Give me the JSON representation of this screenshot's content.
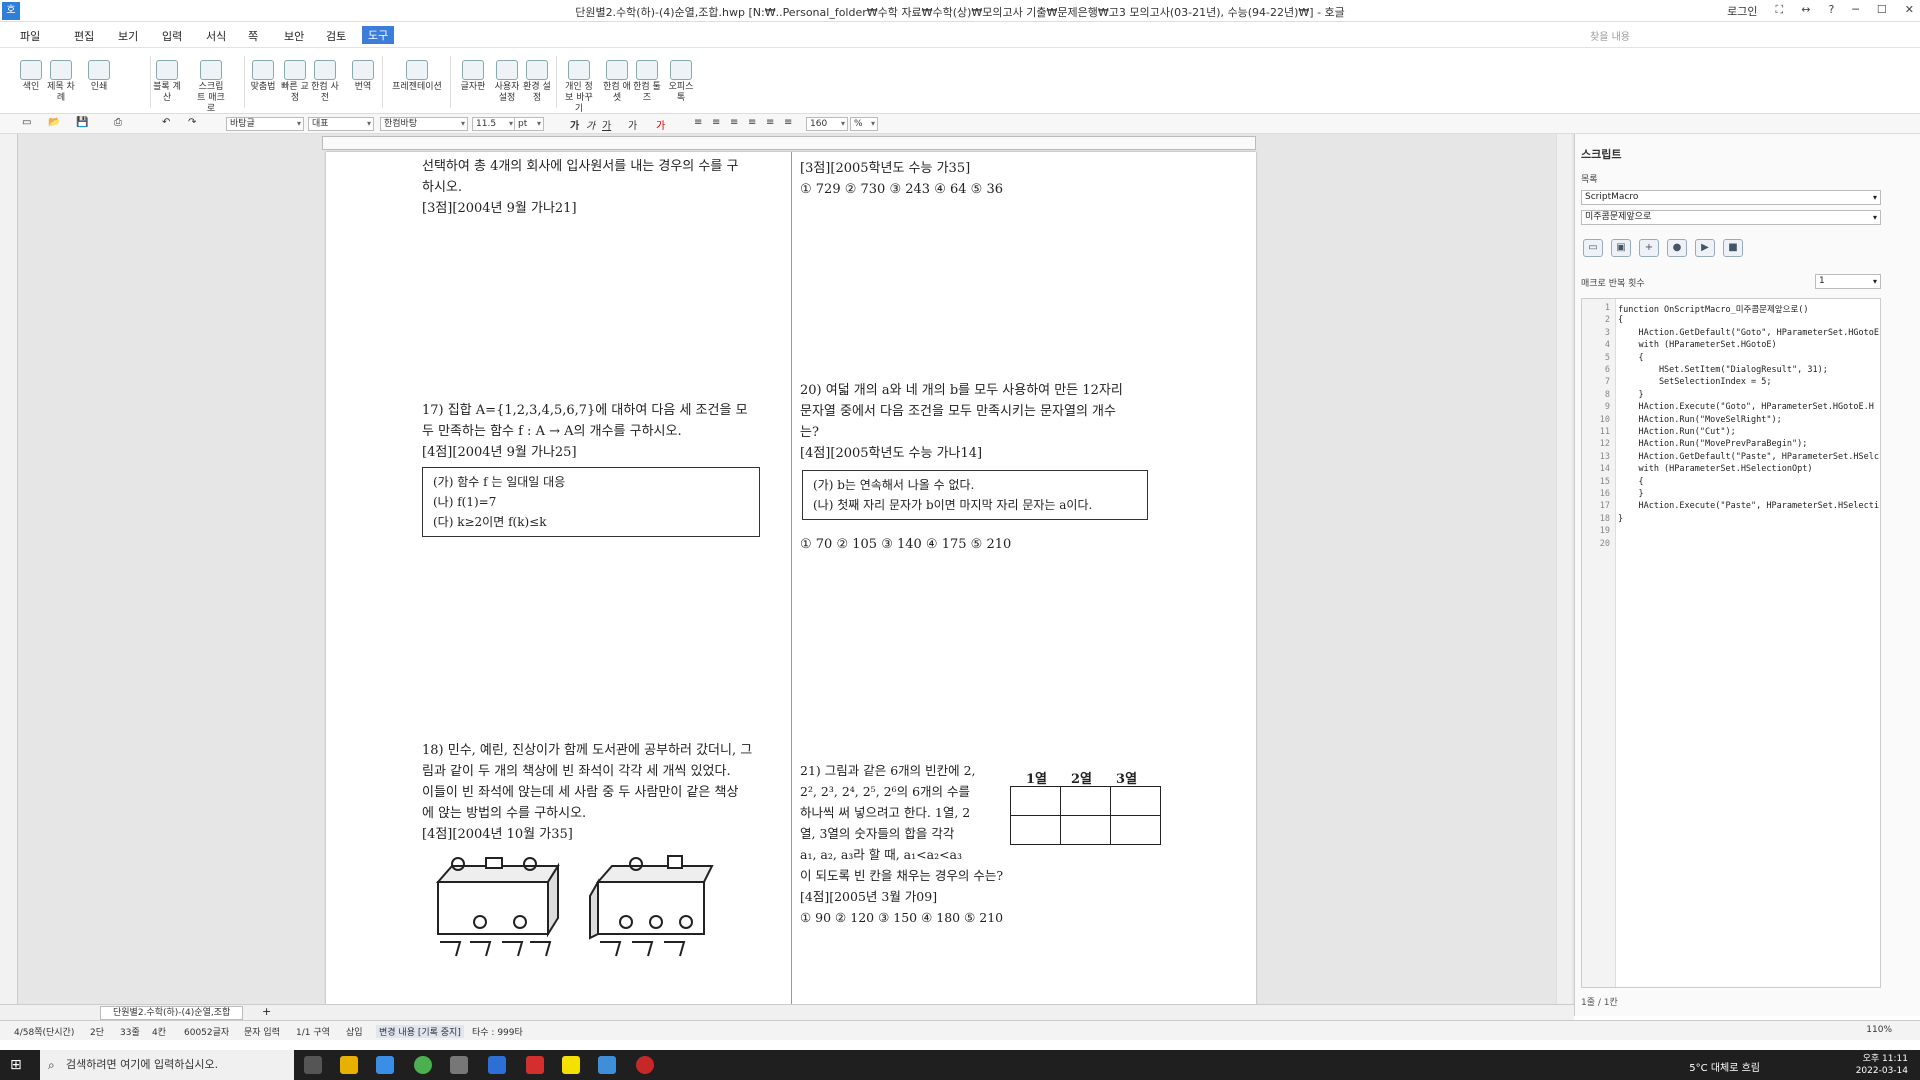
{
  "window": {
    "app_logo": "호",
    "title": "단원별2.수학(하)-(4)순열,조합.hwp [N:₩..Personal_folder₩수학 자료₩수학(상)₩모의고사 기출₩문제은행₩고3 모의고사(03-21년), 수능(94-22년)₩] - 호글",
    "login": "로그인"
  },
  "menu": {
    "items": [
      "파일",
      "편집",
      "보기",
      "입력",
      "서식",
      "쪽",
      "보안",
      "검토",
      "도구"
    ],
    "active": "도구",
    "help_search": "찾을 내용"
  },
  "ribbon": {
    "buttons": [
      "색인",
      "제목 차례",
      "인쇄",
      "블록 계산",
      "스크립트 매크로",
      "맞춤법",
      "빠른 교정",
      "한컴 사전",
      "번역",
      "프레젠테이션",
      "글자판",
      "사용자 설정",
      "환경 설정",
      "개인 정보 바꾸기",
      "한컴 애셋",
      "한컴 툴즈",
      "오피스 톡"
    ]
  },
  "format_bar": {
    "style": "바탕글",
    "lang": "대표",
    "font": "한컴바탕",
    "size": "11.5",
    "unit": "pt",
    "zoom": "160",
    "zoom_unit": "%"
  },
  "document": {
    "left_col": {
      "q16_tail": [
        "선택하여 총 4개의 회사에 입사원서를 내는 경우의 수를 구",
        "하시오."
      ],
      "q16_src": "[3점][2004년 9월 가나21]",
      "q17": [
        "17) 집합 A={1,2,3,4,5,6,7}에 대하여 다음 세 조건을 모",
        "두 만족하는 함수 f : A → A의 개수를 구하시오."
      ],
      "q17_src": "[4점][2004년 9월 가나25]",
      "q17_conds": [
        "(가) 함수 f 는 일대일 대응",
        "(나) f(1)=7",
        "(다) k≥2이면 f(k)≤k"
      ],
      "q18": [
        "18) 민수, 예린, 진상이가 함께 도서관에 공부하러 갔더니, 그",
        "림과 같이 두 개의 책상에 빈 좌석이 각각 세 개씩 있었다.",
        "이들이 빈 좌석에 앉는데 세 사람 중 두 사람만이 같은 책상",
        "에 앉는 방법의 수를 구하시오."
      ],
      "q18_src": "[4점][2004년 10월 가35]"
    },
    "right_col": {
      "q19_src": "[3점][2005학년도 수능 가35]",
      "q19_choices": "① 729  ② 730  ③ 243  ④ 64  ⑤ 36",
      "q20": [
        "20) 여덟 개의 a와 네 개의 b를 모두 사용하여 만든 12자리",
        "문자열 중에서 다음 조건을 모두 만족시키는 문자열의 개수",
        "는?"
      ],
      "q20_src": "[4점][2005학년도 수능 가나14]",
      "q20_conds": [
        "(가) b는 연속해서 나올 수 없다.",
        "(나) 첫째 자리 문자가 b이면 마지막 자리 문자는 a이다."
      ],
      "q20_choices": "① 70   ② 105  ③ 140  ④ 175  ⑤ 210",
      "q21": [
        "21) 그림과 같은 6개의 빈칸에 2,",
        "2², 2³, 2⁴, 2⁵, 2⁶의 6개의 수를",
        "하나씩 써 넣으려고 한다. 1열, 2",
        "열, 3열의 숫자들의 합을 각각",
        "a₁, a₂, a₃라 할 때, a₁<a₂<a₃",
        "이 되도록 빈 칸을 채우는 경우의 수는?"
      ],
      "q21_src": "[4점][2005년 3월 가09]",
      "q21_choices": "① 90   ② 120  ③ 150  ④ 180  ⑤ 210",
      "grid_headers": [
        "1열",
        "2열",
        "3열"
      ]
    }
  },
  "script_panel": {
    "title": "스크립트",
    "list_label": "목록",
    "list_value": "ScriptMacro",
    "macro_value": "미주콤문제앞으로",
    "repeat_label": "매크로 반복 횟수",
    "repeat_value": "1",
    "code": [
      "function OnScriptMacro_미주콤문제앞으로()",
      "{",
      "    HAction.GetDefault(\"Goto\", HParameterSet.HGotoE",
      "    with (HParameterSet.HGotoE)",
      "    {",
      "        HSet.SetItem(\"DialogResult\", 31);",
      "        SetSelectionIndex = 5;",
      "    }",
      "    HAction.Execute(\"Goto\", HParameterSet.HGotoE.H",
      "    HAction.Run(\"MoveSelRight\");",
      "    HAction.Run(\"Cut\");",
      "    HAction.Run(\"MovePrevParaBegin\");",
      "    HAction.GetDefault(\"Paste\", HParameterSet.HSelc",
      "    with (HParameterSet.HSelectionOpt)",
      "    {",
      "    }",
      "    HAction.Execute(\"Paste\", HParameterSet.HSelecti",
      "}",
      "",
      ""
    ],
    "page": "1줄 / 1칸"
  },
  "tabs": {
    "doc_tab": "단원별2.수학(하)-(4)순열,조합",
    "add": "+"
  },
  "status": {
    "items": [
      "4/58쪽(단시간)",
      "2단",
      "33줄",
      "4칸",
      "60052글자",
      "문자 입력",
      "1/1 구역",
      "삽입",
      "변경 내용 [기록 중지]",
      "타수 : 999타"
    ],
    "zoom": "110%"
  },
  "taskbar": {
    "search": "검색하려면 여기에 입력하십시오.",
    "weather": "5°C 대체로 흐림",
    "time": "오후 11:11",
    "date": "2022-03-14"
  }
}
